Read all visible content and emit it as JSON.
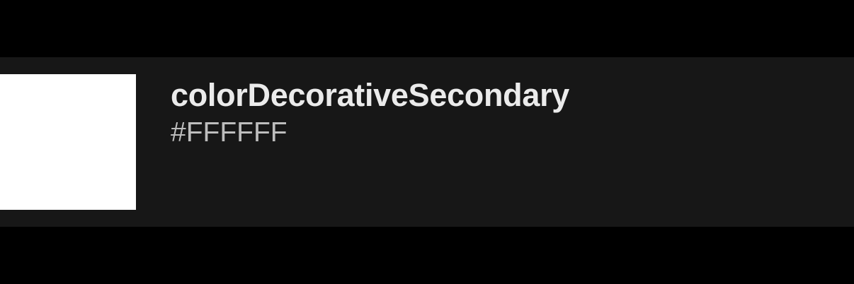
{
  "token": {
    "name": "colorDecorativeSecondary",
    "value": "#FFFFFF",
    "swatch_color": "#FFFFFF"
  },
  "colors": {
    "background": "#000000",
    "row_background": "#171717",
    "name_text": "#EBEBEB",
    "value_text": "#BDBDBD"
  }
}
